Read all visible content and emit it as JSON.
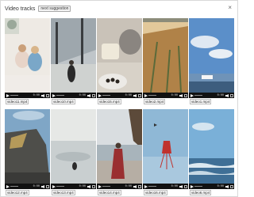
{
  "dialog": {
    "title": "Video tracks",
    "suggest_label": "next suggestion",
    "close_glyph": "×"
  },
  "controls": {
    "time_label": "0:00",
    "icons": [
      "play-icon",
      "seek-icon",
      "volume-icon",
      "fullscreen-icon",
      "more-icon"
    ]
  },
  "videos": [
    {
      "file": "video11.mp4"
    },
    {
      "file": "video10.mp4"
    },
    {
      "file": "video15.mp4"
    },
    {
      "file": "video2.mp4"
    },
    {
      "file": "video1.mp4"
    },
    {
      "file": "video12.mp4"
    },
    {
      "file": "video13.mp4"
    },
    {
      "file": "video14.mp4"
    },
    {
      "file": "video16.mp4"
    },
    {
      "file": "video6.mp4"
    }
  ],
  "colors": {
    "control_bar": "#111111",
    "accent": "#3b82f6"
  }
}
